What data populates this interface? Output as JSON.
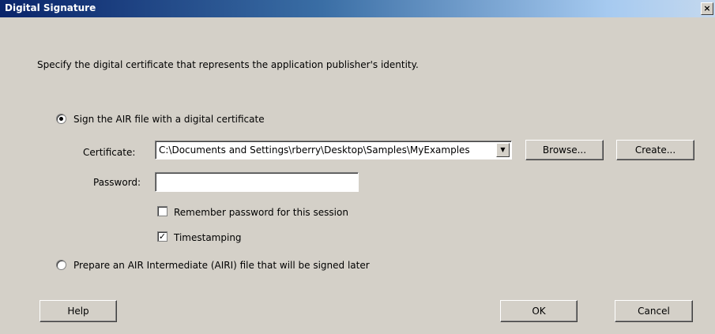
{
  "window": {
    "title": "Digital Signature",
    "close_glyph": "×"
  },
  "intro": "Specify the digital certificate that represents the application publisher's identity.",
  "options": {
    "sign": {
      "label": "Sign the AIR file with a digital certificate",
      "selected": true
    },
    "prepare": {
      "label": "Prepare an AIR Intermediate (AIRI) file that will be signed later",
      "selected": false
    }
  },
  "certificate": {
    "label": "Certificate:",
    "value": "C:\\Documents and Settings\\rberry\\Desktop\\Samples\\MyExamples",
    "arrow_icon": "▼"
  },
  "password": {
    "label": "Password:",
    "value": ""
  },
  "checks": {
    "remember": {
      "label": "Remember password for this session",
      "checked": false
    },
    "timestamp": {
      "label": "Timestamping",
      "checked": true,
      "glyph": "✓"
    }
  },
  "buttons": {
    "browse": "Browse...",
    "create": "Create...",
    "help": "Help",
    "ok": "OK",
    "cancel": "Cancel"
  }
}
